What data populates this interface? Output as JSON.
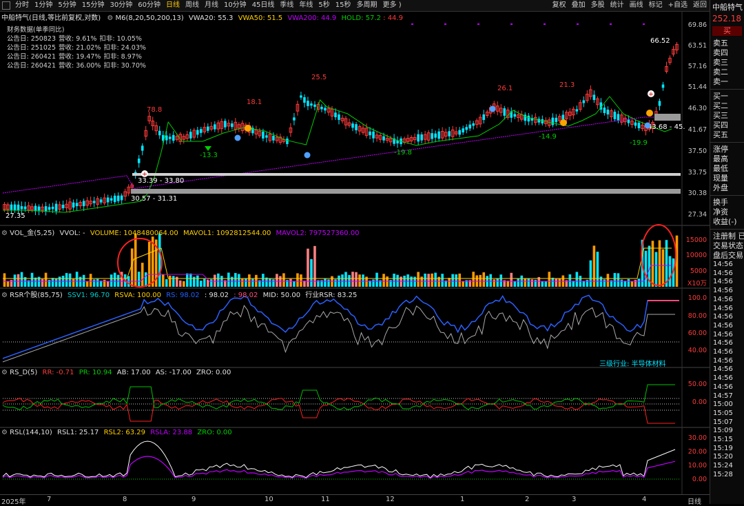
{
  "colors": {
    "up": "#ff3b3b",
    "down": "#00e5ff",
    "white": "#ffffff",
    "yellow": "#ffd000",
    "purple": "#c000ff",
    "green": "#00d000",
    "gray": "#8a8a8a",
    "orange": "#ff9a00",
    "pink": "#ff4d7a",
    "blue": "#2060ff"
  },
  "toolbar": {
    "periods": [
      "分时",
      "1分钟",
      "5分钟",
      "15分钟",
      "30分钟",
      "60分钟",
      "日线",
      "周线",
      "月线",
      "10分钟",
      "45日线",
      "季线",
      "年线",
      "5秒",
      "15秒",
      "多周期",
      "更多 )"
    ],
    "active_period": "日线",
    "right_buttons": [
      "复权",
      "叠加",
      "多股",
      "统计",
      "画线",
      "标记",
      "+自选",
      "返回"
    ]
  },
  "main_chart": {
    "stock": "中船特气(日线,等比前复权,对数)",
    "indicator_name": "M6(8,20,50,200,13)",
    "vwa20": "VWA20: 55.3",
    "vwa50": "VWA50: 51.5",
    "vwa200": "VWA200: 44.9",
    "hold": "HOLD: 57.2",
    "hold2": ": 44.9",
    "financial_title": "财务数据(单季同比)",
    "financial_rows": [
      {
        "date": "公告日: 250823",
        "rev": "营收: 9.61%",
        "profit": "扣非: 10.05%"
      },
      {
        "date": "公告日: 251025",
        "rev": "营收: 21.02%",
        "profit": "扣非: 24.03%"
      },
      {
        "date": "公告日: 260421",
        "rev": "营收: 19.47%",
        "profit": "扣非: 8.97%"
      },
      {
        "date": "公告日: 260421",
        "rev": "营收: 36.00%",
        "profit": "扣非: 30.70%"
      }
    ],
    "y_ticks": [
      "69.86",
      "63.51",
      "57.16",
      "51.44",
      "46.30",
      "41.67",
      "37.50",
      "33.75",
      "30.38",
      "27.34"
    ],
    "labels": {
      "p_7888": "78.8",
      "p_181": "18.1",
      "p_255": "25.5",
      "p_261": "26.1",
      "p_213": "21.3",
      "p_6652": "66.52",
      "n_2735": "27.35",
      "n_133": "-13.3",
      "n_198": "-19.8",
      "n_149": "-14.9",
      "n_199": "-19.9",
      "zone1": "33.39 - 33.80",
      "zone2": "30.57 - 31.31",
      "zone3": "43.68 - 45."
    }
  },
  "vol_panel": {
    "name": "VOL_金(5,25)",
    "vvol": "VVOL: -",
    "volume": "VOLUME: 1048480064.00",
    "mavol1": "MAVOL1: 1092812544.00",
    "mavol2": "MAVOL2: 797527360.00",
    "y_ticks": [
      "15000",
      "10000",
      "5000"
    ],
    "unit": "X10万"
  },
  "rsr_panel": {
    "name": "RSR个股(85,75)",
    "ssv1": "SSV1: 96.70",
    "rsva": "RSVA: 100.00",
    "rs2": "RS: 98.02",
    "rs3": ": 98.02",
    "rs4": ": 98.02",
    "mid": "MID: 50.00",
    "industry": "行业RSR: 83.25",
    "y_ticks": [
      "100.0",
      "80.00",
      "60.00",
      "40.00"
    ],
    "industry_label": "三级行业: 半导体材料"
  },
  "rsd_panel": {
    "name": "RS_D(5)",
    "rr": "RR: -0.71",
    "pr": "PR: 10.94",
    "ab": "AB: 17.00",
    "as": "AS: -17.00",
    "zro": "ZRO: 0.00",
    "y_ticks": [
      "50.00",
      "0.00"
    ]
  },
  "rsl_panel": {
    "name": "RSL(144,10)",
    "rsl1": "RSL1: 25.17",
    "rsl2": "RSL2: 63.29",
    "rsla": "RSLA: 23.88",
    "zro": "ZRO: 0.00",
    "y_ticks": [
      "30.00",
      "20.00",
      "10.00",
      "0.00"
    ]
  },
  "x_axis": {
    "labels": [
      "2025年",
      "7",
      "8",
      "9",
      "10",
      "11",
      "12",
      "1",
      "2",
      "3",
      "4"
    ],
    "period": "日线"
  },
  "sidebar": {
    "name": "中船特气",
    "price": "252.18",
    "buy": "买",
    "sell_levels": [
      "卖五",
      "卖四",
      "卖三",
      "卖二",
      "卖一"
    ],
    "buy_levels": [
      "买一",
      "买二",
      "买三",
      "买四",
      "买五"
    ],
    "stats": [
      "涨停",
      "最高",
      "最低",
      "现量",
      "外盘"
    ],
    "stats2": [
      "换手",
      "净资",
      "收益(-)"
    ],
    "stats3": [
      "注册制 已",
      "交易状态",
      "盘后交易"
    ],
    "times": [
      "14:56",
      "14:56",
      "14:56",
      "14:56",
      "14:56",
      "14:56",
      "14:56",
      "14:56",
      "14:56",
      "14:56",
      "14:56",
      "14:56",
      "14:56",
      "14:56",
      "14:56",
      "14:57",
      "15:00",
      "15:05",
      "15:07",
      "15:09",
      "15:15",
      "15:19",
      "15:20",
      "15:24",
      "15:28"
    ]
  }
}
